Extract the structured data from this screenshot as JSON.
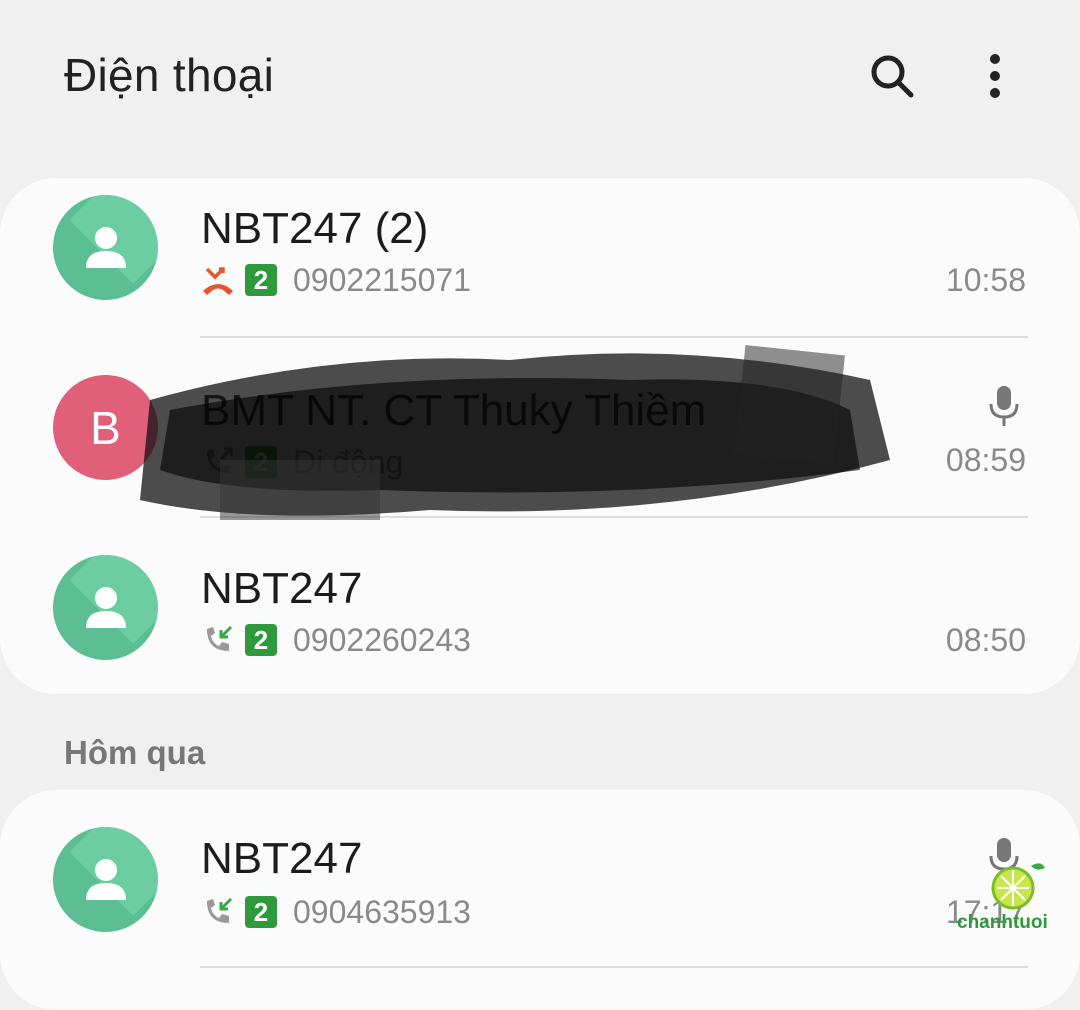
{
  "header": {
    "title": "Điện thoại",
    "search_icon": "search-icon",
    "more_icon": "more-vertical-icon"
  },
  "calls_today": [
    {
      "name": "NBT247 (2)",
      "avatar": "person-icon",
      "call_type": "missed-call-icon",
      "sim": "2",
      "number": "0902215071",
      "time": "10:58"
    },
    {
      "name": "BMT NT. CT Thuky Thiềm",
      "avatar_letter": "B",
      "call_type": "outgoing-call-icon",
      "sim": "2",
      "number": "Di động",
      "time": "08:59",
      "has_recording": true
    },
    {
      "name": "NBT247",
      "avatar": "person-icon",
      "call_type": "incoming-call-icon",
      "sim": "2",
      "number": "0902260243",
      "time": "08:50"
    }
  ],
  "section_yesterday": "Hôm qua",
  "calls_yesterday": [
    {
      "name": "NBT247",
      "avatar": "person-icon",
      "call_type": "incoming-call-icon",
      "sim": "2",
      "number": "0904635913",
      "time": "17:17",
      "has_recording": true
    }
  ],
  "watermark": "chanhtuoi",
  "colors": {
    "avatar_green": "#5cbf94",
    "avatar_pink": "#e0607a",
    "sim_badge": "#2e9a3b",
    "missed_call": "#e4572e",
    "incoming_call": "#3aa845"
  }
}
